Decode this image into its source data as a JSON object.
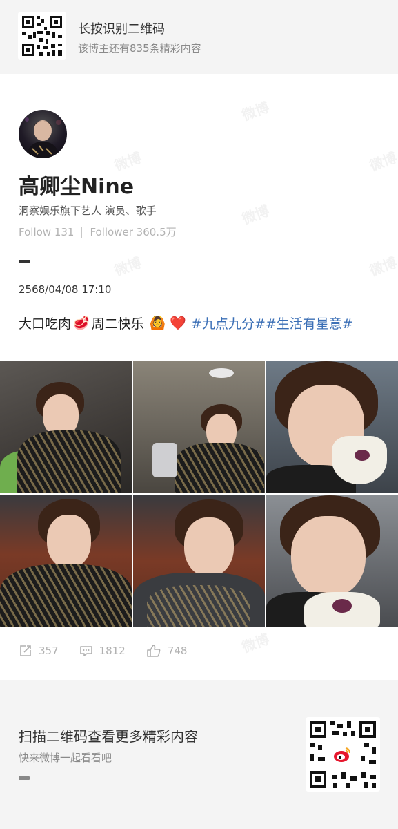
{
  "watermark_text": "微博",
  "top_banner": {
    "title": "长按识别二维码",
    "subtitle": "该博主还有835条精彩内容",
    "qr_icon": "qr-code-icon"
  },
  "profile": {
    "name": "高卿尘Nine",
    "bio": "洞察娱乐旗下艺人 演员、歌手",
    "follow_label": "Follow 131",
    "follower_label": "Follower 360.5万"
  },
  "post": {
    "timestamp": "2568/04/08 17:10",
    "text_before": "大口吃肉",
    "text_after": "周二快乐",
    "emojis": {
      "meat": "🥩",
      "person": "🙆",
      "heart": "❤️"
    },
    "hashtags": "#九点九分##生活有星意#",
    "photo_count": 6
  },
  "actions": {
    "repost": "357",
    "comment": "1812",
    "like": "748"
  },
  "bottom_banner": {
    "title": "扫描二维码查看更多精彩内容",
    "subtitle": "快来微博一起看看吧",
    "qr_icon": "weibo-qr-code-icon"
  },
  "colors": {
    "hashtag": "#3b6fb6",
    "banner_bg": "#f4f4f4",
    "muted_text": "#b0b0b0"
  }
}
